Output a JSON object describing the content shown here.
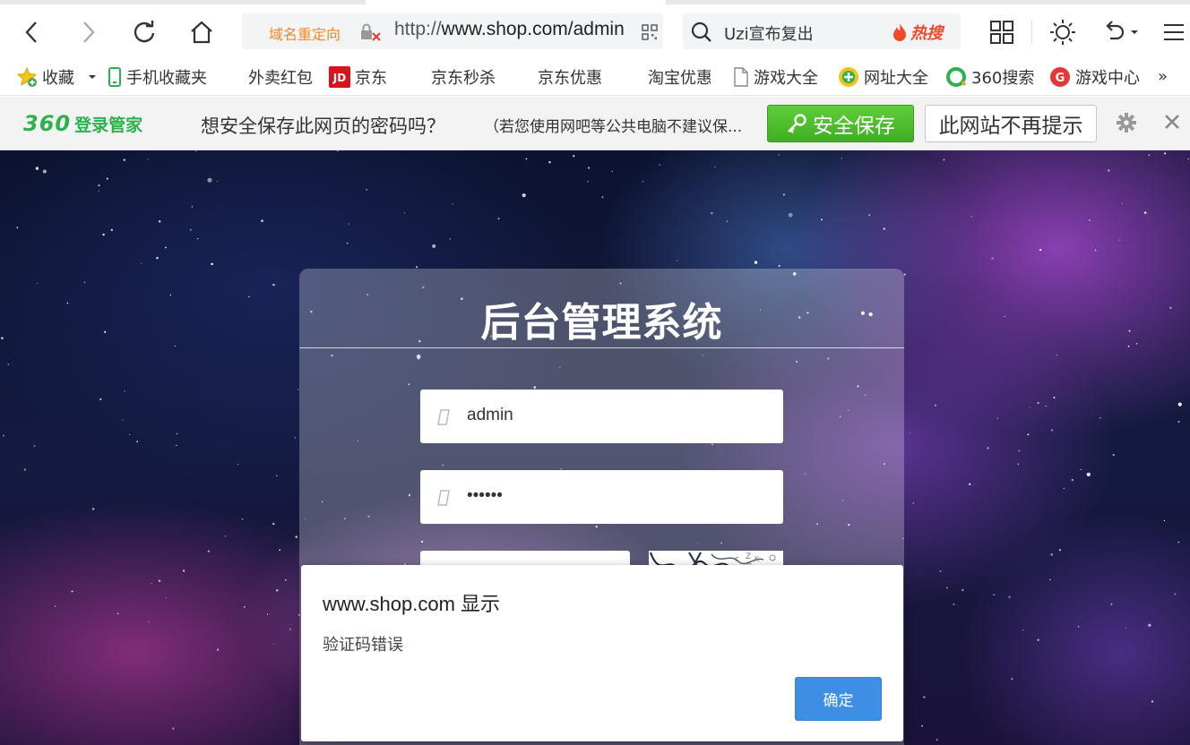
{
  "toolbar": {
    "redirect_label": "域名重定向",
    "url_protocol": "http://",
    "url_rest": "www.shop.com/admin/login",
    "search_text": "Uzi宣布复出",
    "hot_label": "热搜"
  },
  "bookmarks": {
    "items": [
      {
        "label": "收藏"
      },
      {
        "label": "手机收藏夹"
      },
      {
        "label": "外卖红包"
      },
      {
        "label": "京东"
      },
      {
        "label": "京东秒杀"
      },
      {
        "label": "京东优惠"
      },
      {
        "label": "淘宝优惠"
      },
      {
        "label": "游戏大全"
      },
      {
        "label": "网址大全"
      },
      {
        "label": "360搜索"
      },
      {
        "label": "游戏中心"
      }
    ],
    "more": "»"
  },
  "password_bar": {
    "logo_number": "360",
    "logo_name": "登录管家",
    "question": "想安全保存此网页的密码吗？",
    "note": "（若您使用网吧等公共电脑不建议保...",
    "save_label": "安全保存",
    "never_label": "此网站不再提示"
  },
  "login": {
    "title": "后台管理系统",
    "username_value": "admin",
    "password_value": "••••••"
  },
  "alert": {
    "title": "www.shop.com 显示",
    "message": "验证码错误",
    "ok_label": "确定"
  },
  "colors": {
    "brand_green": "#2bb24c",
    "save_green": "#4cbb2c",
    "dialog_blue": "#3e8ee6",
    "redirect_orange": "#f08a24",
    "hot_red": "#f04a2a"
  }
}
